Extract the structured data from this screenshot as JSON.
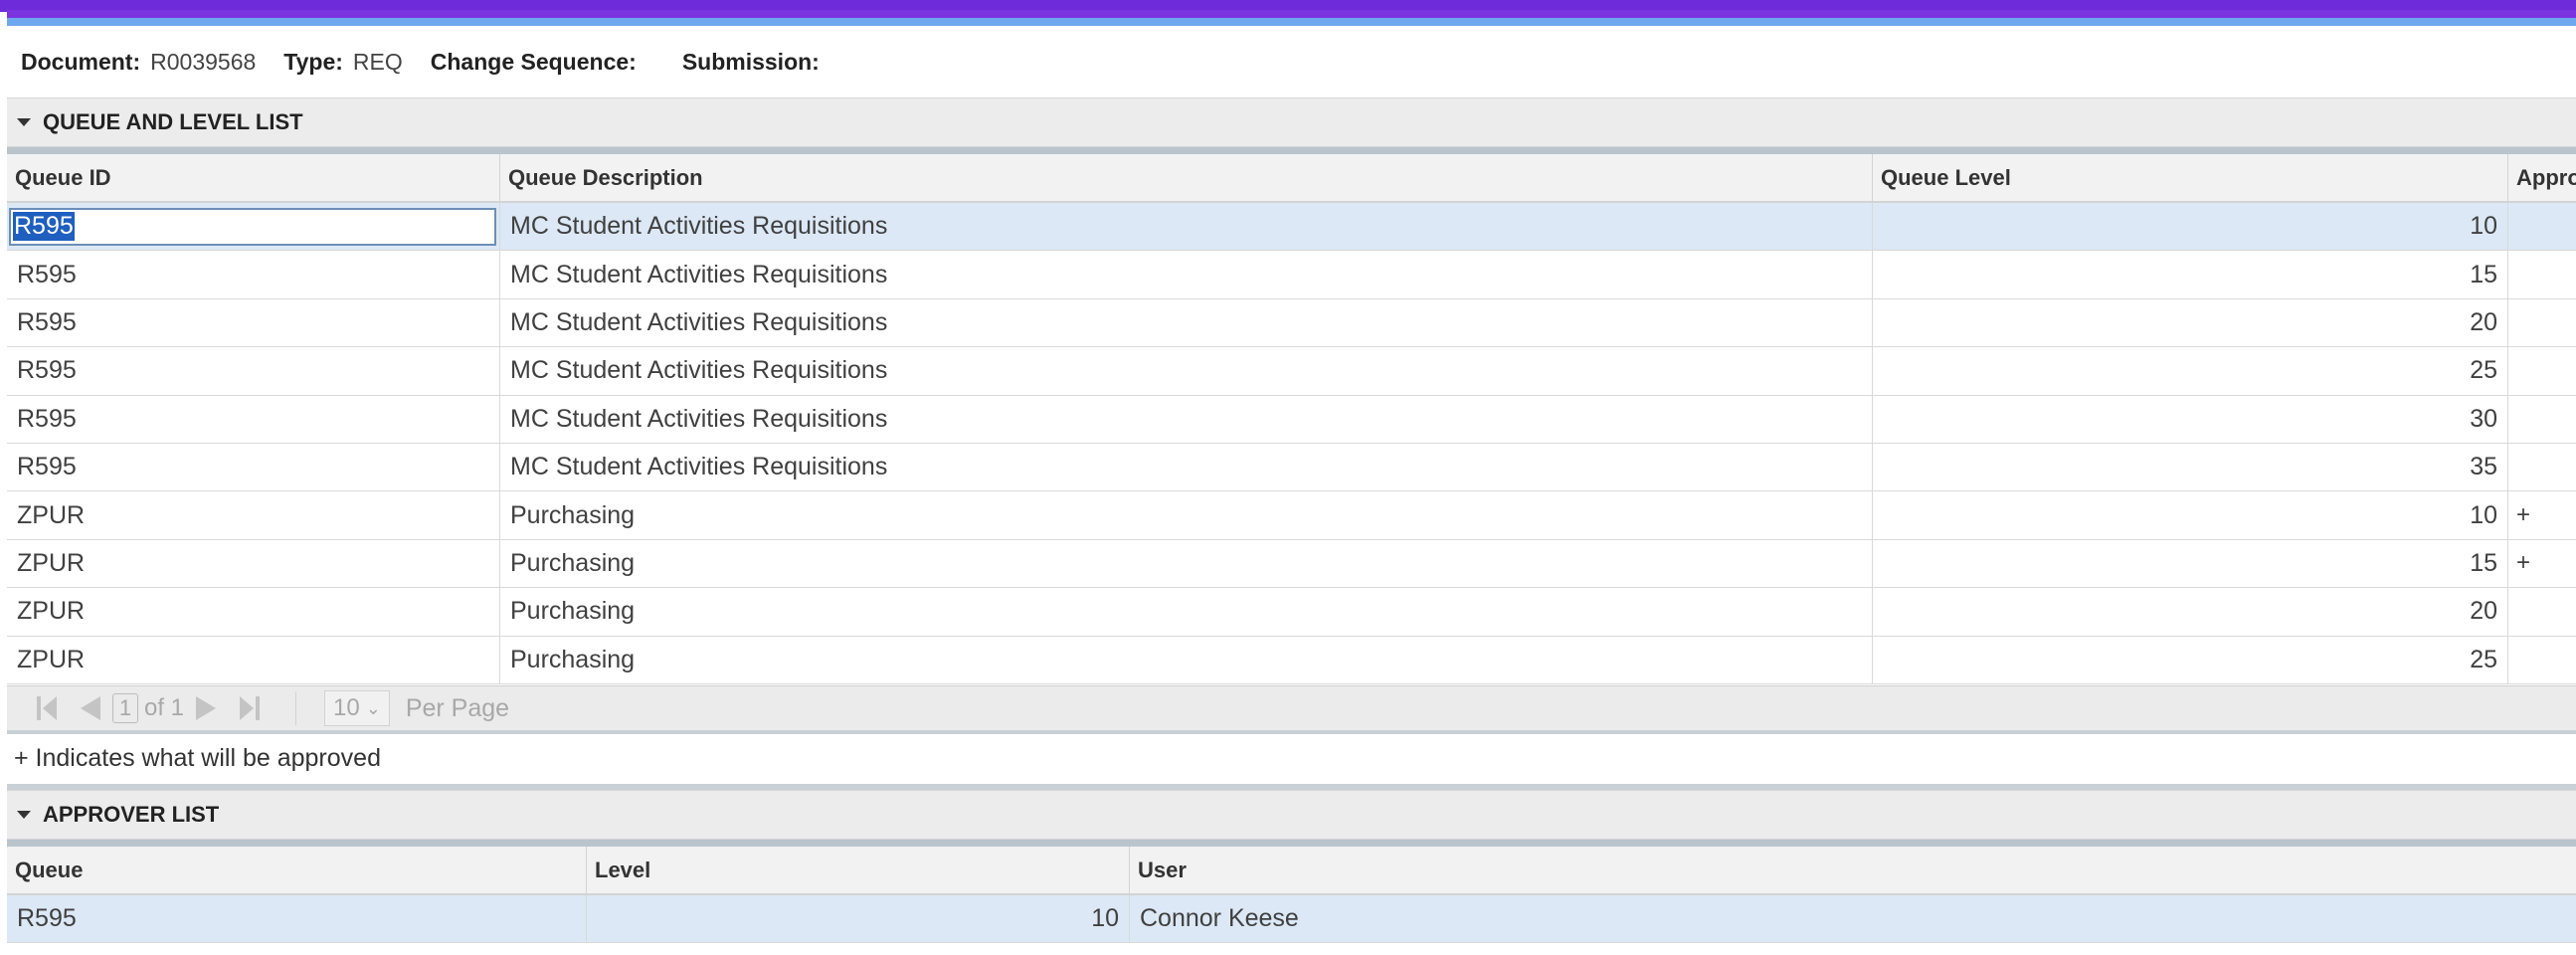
{
  "document_info": {
    "document_label": "Document:",
    "document_value": "R0039568",
    "type_label": "Type:",
    "type_value": "REQ",
    "change_sequence_label": "Change Sequence:",
    "change_sequence_value": "",
    "submission_label": "Submission:",
    "submission_value": ""
  },
  "queue_section": {
    "title": "QUEUE AND LEVEL LIST",
    "columns": [
      "Queue ID",
      "Queue Description",
      "Queue Level",
      "Appro"
    ],
    "rows": [
      {
        "queue_id": "R595",
        "description": "MC Student Activities Requisitions",
        "level": "10",
        "approve": ""
      },
      {
        "queue_id": "R595",
        "description": "MC Student Activities Requisitions",
        "level": "15",
        "approve": ""
      },
      {
        "queue_id": "R595",
        "description": "MC Student Activities Requisitions",
        "level": "20",
        "approve": ""
      },
      {
        "queue_id": "R595",
        "description": "MC Student Activities Requisitions",
        "level": "25",
        "approve": ""
      },
      {
        "queue_id": "R595",
        "description": "MC Student Activities Requisitions",
        "level": "30",
        "approve": ""
      },
      {
        "queue_id": "R595",
        "description": "MC Student Activities Requisitions",
        "level": "35",
        "approve": ""
      },
      {
        "queue_id": "ZPUR",
        "description": "Purchasing",
        "level": "10",
        "approve": "+"
      },
      {
        "queue_id": "ZPUR",
        "description": "Purchasing",
        "level": "15",
        "approve": "+"
      },
      {
        "queue_id": "ZPUR",
        "description": "Purchasing",
        "level": "20",
        "approve": ""
      },
      {
        "queue_id": "ZPUR",
        "description": "Purchasing",
        "level": "25",
        "approve": ""
      }
    ],
    "pager": {
      "current_page": "1",
      "of_label": "of 1",
      "per_page_value": "10",
      "per_page_label": "Per Page"
    },
    "note": "+ Indicates what will be approved"
  },
  "approver_section": {
    "title": "APPROVER LIST",
    "columns": [
      "Queue",
      "Level",
      "User"
    ],
    "rows": [
      {
        "queue": "R595",
        "level": "10",
        "user": "Connor Keese"
      }
    ]
  },
  "colors": {
    "accent_purple": "#6d2bd9",
    "accent_blue": "#6ea8ee",
    "selected_row": "#dce8f5",
    "selection_highlight": "#1e5fc0"
  }
}
